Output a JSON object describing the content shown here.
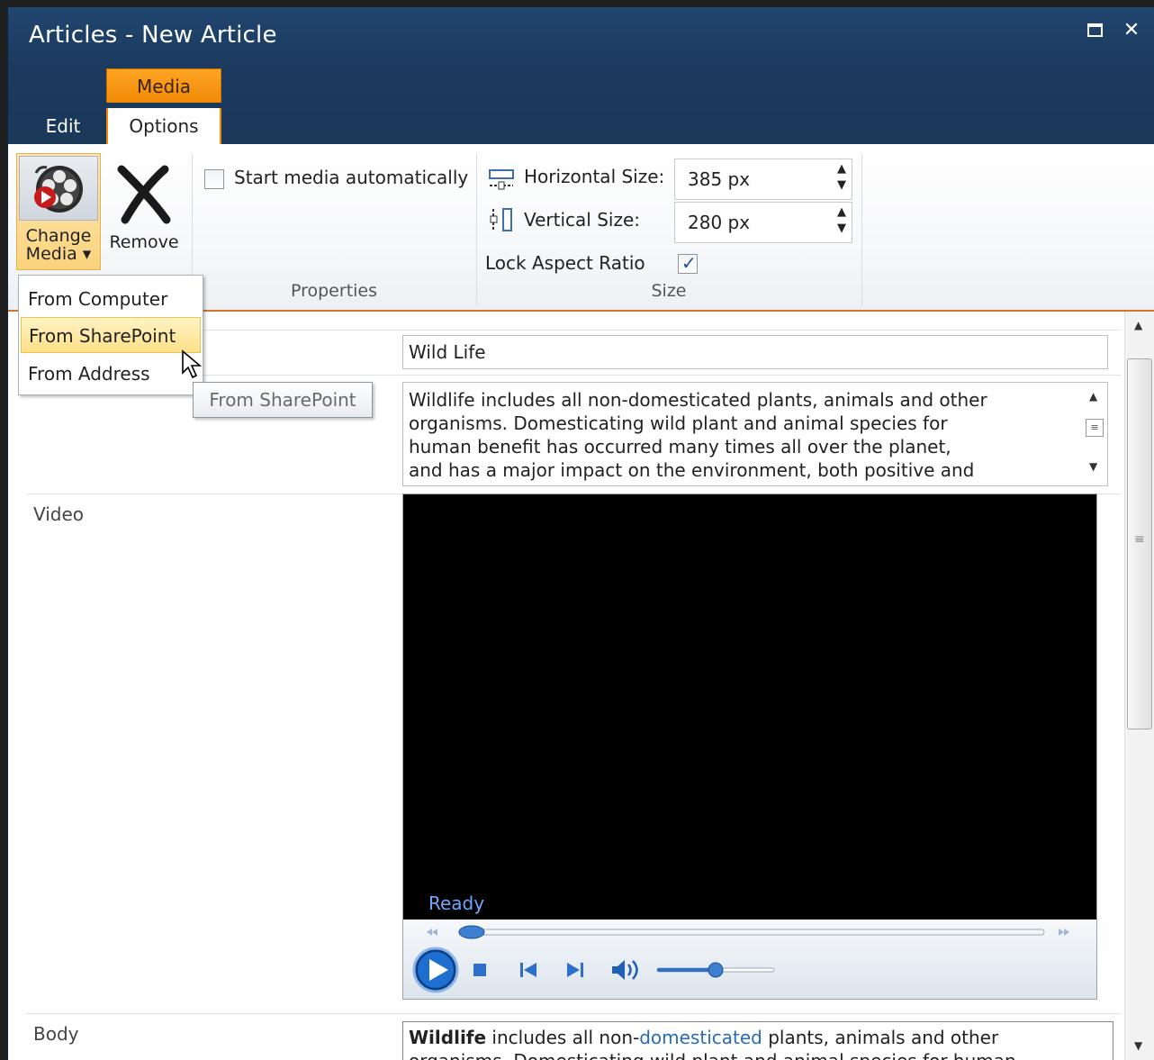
{
  "window": {
    "title": "Articles - New Article",
    "maximize_label": "□",
    "close_label": "✕"
  },
  "ribbon": {
    "contextual_group": "Media",
    "tabs": [
      {
        "label": "Edit",
        "selected": false
      },
      {
        "label": "Options",
        "selected": true
      }
    ],
    "change_media": {
      "line1": "Change",
      "line2": "Media ▾"
    },
    "remove_label": "Remove",
    "start_auto_label": "Start media automatically",
    "start_auto_checked": false,
    "properties_group_label": "Properties",
    "horizontal_size_label": "Horizontal Size:",
    "horizontal_size_value": "385 px",
    "vertical_size_label": "Vertical Size:",
    "vertical_size_value": "280 px",
    "lock_aspect_label": "Lock Aspect Ratio",
    "lock_aspect_checked": true,
    "size_group_label": "Size"
  },
  "menu": {
    "items": [
      {
        "label": "From Computer",
        "highlighted": false
      },
      {
        "label": "From SharePoint",
        "highlighted": true
      },
      {
        "label": "From Address",
        "highlighted": false
      }
    ],
    "tooltip": "From SharePoint"
  },
  "form": {
    "title_value": "Wild Life",
    "summary_lines": [
      "Wildlife includes all non-domesticated plants, animals and other",
      "organisms. Domesticating wild plant and animal species for",
      "human benefit has occurred many times all over the planet,",
      "and has a major impact on the environment, both positive and"
    ],
    "video_label": "Video",
    "player_status": "Ready",
    "player_progress": 0.0,
    "player_volume": 0.5,
    "body_label": "Body",
    "body_line1": {
      "bold": "Wildlife",
      "t1": " includes all non-",
      "link": "domesticated",
      "t2": " plants, animals and other"
    },
    "body_line2": "organisms. Domesticating wild plant and animal species for human"
  },
  "colors": {
    "title_bar": "#1b3a5e",
    "context_tab": "#f08a05",
    "menu_highlight": "#ffe089",
    "link": "#2a6bb5"
  }
}
